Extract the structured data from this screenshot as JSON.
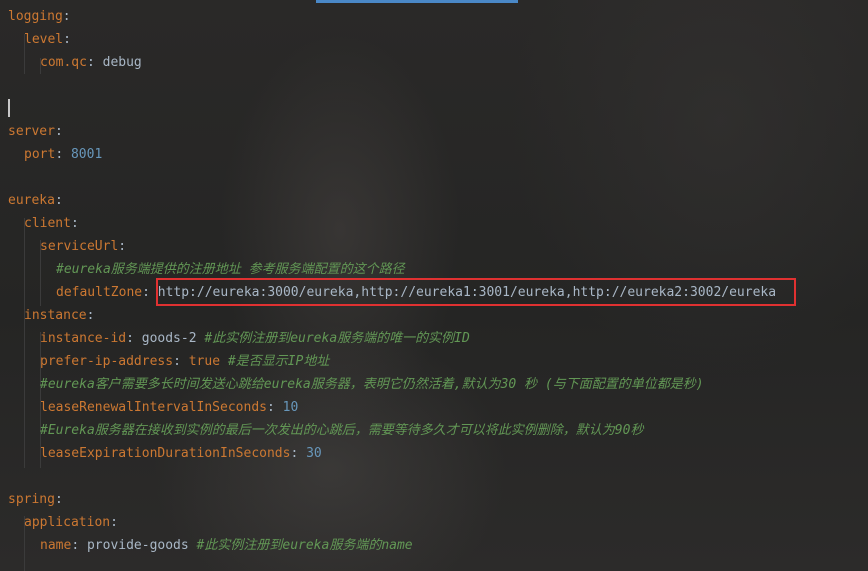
{
  "lines": {
    "l1": {
      "key": "logging",
      "sep": ":"
    },
    "l2": {
      "key": "level",
      "sep": ":"
    },
    "l3": {
      "key": "com.qc",
      "sep": ": ",
      "value": "debug"
    },
    "l4": {
      "key": "server",
      "sep": ":"
    },
    "l5": {
      "key": "port",
      "sep": ": ",
      "value": "8001"
    },
    "l6": {
      "key": "eureka",
      "sep": ":"
    },
    "l7": {
      "key": "client",
      "sep": ":"
    },
    "l8": {
      "key": "serviceUrl",
      "sep": ":"
    },
    "l9": {
      "comment": "#eureka服务端提供的注册地址 参考服务端配置的这个路径"
    },
    "l10": {
      "key": "defaultZone",
      "sep": ": ",
      "value": "http://eureka:3000/eureka,http://eureka1:3001/eureka,http://eureka2:3002/eureka"
    },
    "l11": {
      "key": "instance",
      "sep": ":"
    },
    "l12": {
      "key": "instance-id",
      "sep": ": ",
      "value": "goods-2",
      "comment": " #此实例注册到eureka服务端的唯一的实例ID"
    },
    "l13": {
      "key": "prefer-ip-address",
      "sep": ": ",
      "value": "true",
      "comment": " #是否显示IP地址"
    },
    "l14": {
      "comment": "#eureka客户需要多长时间发送心跳给eureka服务器，表明它仍然活着,默认为30 秒 (与下面配置的单位都是秒)"
    },
    "l15": {
      "key": "leaseRenewalIntervalInSeconds",
      "sep": ": ",
      "value": "10"
    },
    "l16": {
      "comment": "#Eureka服务器在接收到实例的最后一次发出的心跳后，需要等待多久才可以将此实例删除，默认为90秒"
    },
    "l17": {
      "key": "leaseExpirationDurationInSeconds",
      "sep": ": ",
      "value": "30"
    },
    "l18": {
      "key": "spring",
      "sep": ":"
    },
    "l19": {
      "key": "application",
      "sep": ":"
    },
    "l20": {
      "key": "name",
      "sep": ": ",
      "value": "provide-goods",
      "comment": " #此实例注册到eureka服务端的name"
    }
  },
  "colors": {
    "key": "#cc7832",
    "value": "#a9b7c6",
    "number": "#6897bb",
    "comment": "#629755",
    "highlight_border": "#e03131",
    "tab_accent": "#4a88c7"
  }
}
